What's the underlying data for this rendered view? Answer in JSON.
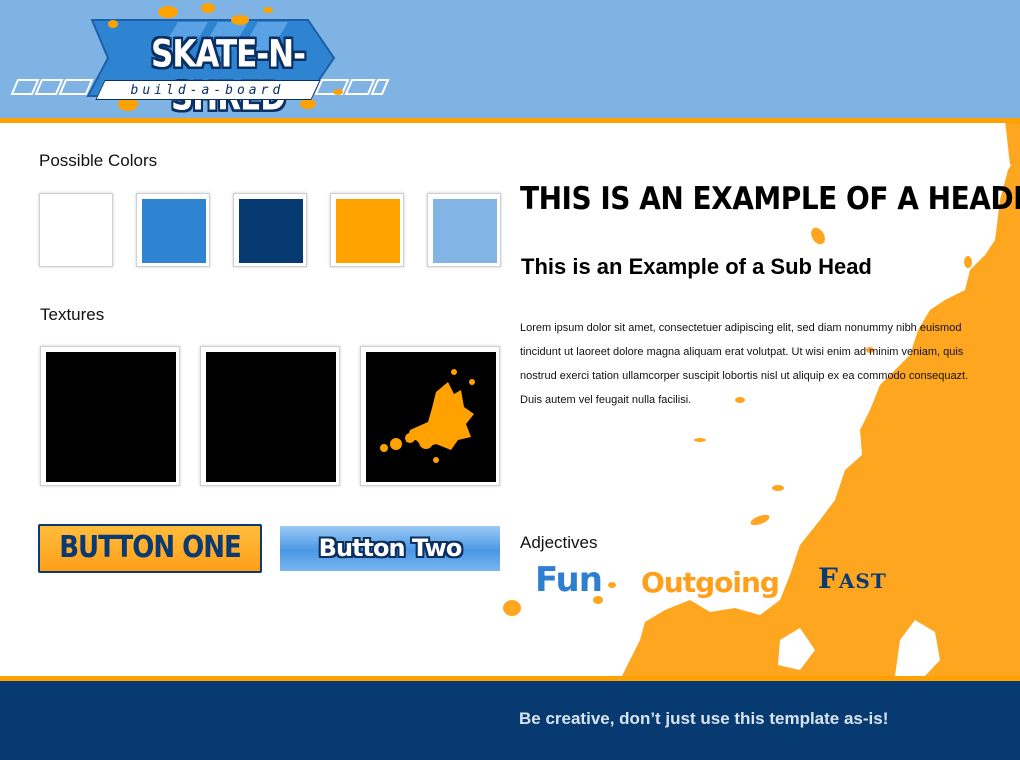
{
  "logo": {
    "title": "SKATE-N-SHRED",
    "tagline": "build-a-board"
  },
  "colors_section": {
    "label": "Possible Colors",
    "swatches": [
      "#ffffff",
      "#2f84d2",
      "#063a70",
      "#ffa200",
      "#82b5e5"
    ]
  },
  "textures_section": {
    "label": "Textures",
    "items": [
      "black",
      "black",
      "black-orange-splatter"
    ]
  },
  "buttons": {
    "one": "BUTTON ONE",
    "two": "Button Two"
  },
  "content": {
    "header": "THIS IS AN EXAMPLE OF A HEADER",
    "subhead": "This is an Example of a Sub Head",
    "body": "Lorem ipsum dolor sit amet, consectetuer adipiscing elit, sed diam nonummy nibh euismod tincidunt ut laoreet dolore magna aliquam erat volutpat. Ut wisi enim ad minim veniam, quis nostrud exerci tation ullamcorper suscipit lobortis nisl ut aliquip ex ea commodo consequazt. Duis autem vel feugait nulla facilisi."
  },
  "adjectives": {
    "label": "Adjectives",
    "items": [
      "Fun",
      "Outgoing",
      "Fast"
    ]
  },
  "footer": {
    "text": "Be creative, don’t just use this template as-is!"
  },
  "theme": {
    "light_blue": "#7fb3e3",
    "orange": "#ffa200",
    "navy": "#063a70",
    "blue": "#2f84d2"
  }
}
